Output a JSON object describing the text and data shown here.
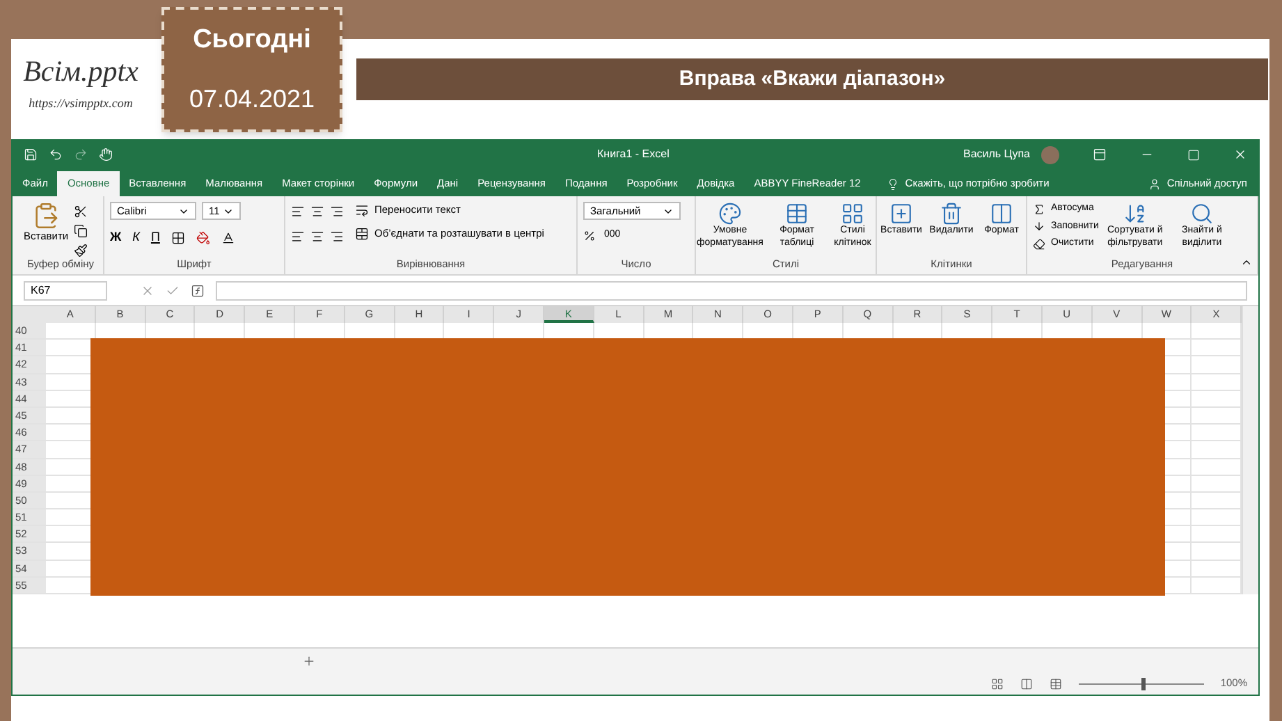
{
  "header": {
    "logo_title": "Всім.pptx",
    "logo_url": "https://vsimpptx.com",
    "date_label": "Сьогодні",
    "date": "07.04.2021",
    "slide_title": "Вправа «Вкажи діапазон»"
  },
  "excel": {
    "title": "Книга1 - Excel",
    "user": "Василь Цупа",
    "tabs": [
      {
        "label": "Файл",
        "selected": false
      },
      {
        "label": "Основне",
        "selected": true
      },
      {
        "label": "Вставлення",
        "selected": false
      },
      {
        "label": "Малювання",
        "selected": false
      },
      {
        "label": "Макет сторінки",
        "selected": false
      },
      {
        "label": "Формули",
        "selected": false
      },
      {
        "label": "Дані",
        "selected": false
      },
      {
        "label": "Рецензування",
        "selected": false
      },
      {
        "label": "Подання",
        "selected": false
      },
      {
        "label": "Розробник",
        "selected": false
      },
      {
        "label": "Довідка",
        "selected": false
      },
      {
        "label": "ABBYY FineReader 12",
        "selected": false
      }
    ],
    "tell_me": "Скажіть, що потрібно зробити",
    "share": "Спільний доступ",
    "groups": [
      {
        "kind": "clipboard",
        "label": "Буфер обміну",
        "paste": "Вставити"
      },
      {
        "kind": "font",
        "label": "Шрифт",
        "font": "Calibri",
        "size": "11",
        "bold": "Ж",
        "italic": "К",
        "underline": "П"
      },
      {
        "kind": "alignment",
        "label": "Вирівнювання",
        "wrap": "Переносити текст",
        "merge": "Об’єднати та розташувати в центрі"
      },
      {
        "kind": "number",
        "label": "Число",
        "format": "Загальний",
        "thousands": "000"
      },
      {
        "kind": "buttons",
        "label": "Стилі",
        "buttons": [
          "Умовне форматування",
          "Формат таблиці",
          "Стилі клітинок"
        ]
      },
      {
        "kind": "buttons",
        "label": "Клітинки",
        "buttons": [
          "Вставити",
          "Видалити",
          "Формат"
        ]
      },
      {
        "kind": "editing",
        "label": "Редагування",
        "list": [
          "Автосума",
          "Заповнити",
          "Очистити"
        ],
        "buttons": [
          "Сортувати й фільтрувати",
          "Знайти й виділити"
        ]
      }
    ],
    "name_box": "K67",
    "columns": [
      {
        "label": "A",
        "selected": false
      },
      {
        "label": "B",
        "selected": false
      },
      {
        "label": "C",
        "selected": false
      },
      {
        "label": "D",
        "selected": false
      },
      {
        "label": "E",
        "selected": false
      },
      {
        "label": "F",
        "selected": false
      },
      {
        "label": "G",
        "selected": false
      },
      {
        "label": "H",
        "selected": false
      },
      {
        "label": "I",
        "selected": false
      },
      {
        "label": "J",
        "selected": false
      },
      {
        "label": "K",
        "selected": true
      },
      {
        "label": "L",
        "selected": false
      },
      {
        "label": "M",
        "selected": false
      },
      {
        "label": "N",
        "selected": false
      },
      {
        "label": "O",
        "selected": false
      },
      {
        "label": "P",
        "selected": false
      },
      {
        "label": "Q",
        "selected": false
      },
      {
        "label": "R",
        "selected": false
      },
      {
        "label": "S",
        "selected": false
      },
      {
        "label": "T",
        "selected": false
      },
      {
        "label": "U",
        "selected": false
      },
      {
        "label": "V",
        "selected": false
      },
      {
        "label": "W",
        "selected": false
      },
      {
        "label": "X",
        "selected": false
      }
    ],
    "rows": [
      "40",
      "41",
      "42",
      "43",
      "44",
      "45",
      "46",
      "47",
      "48",
      "49",
      "50",
      "51",
      "52",
      "53",
      "54",
      "55"
    ],
    "zoom": {
      "level": 0.5,
      "reading": "100%"
    }
  }
}
